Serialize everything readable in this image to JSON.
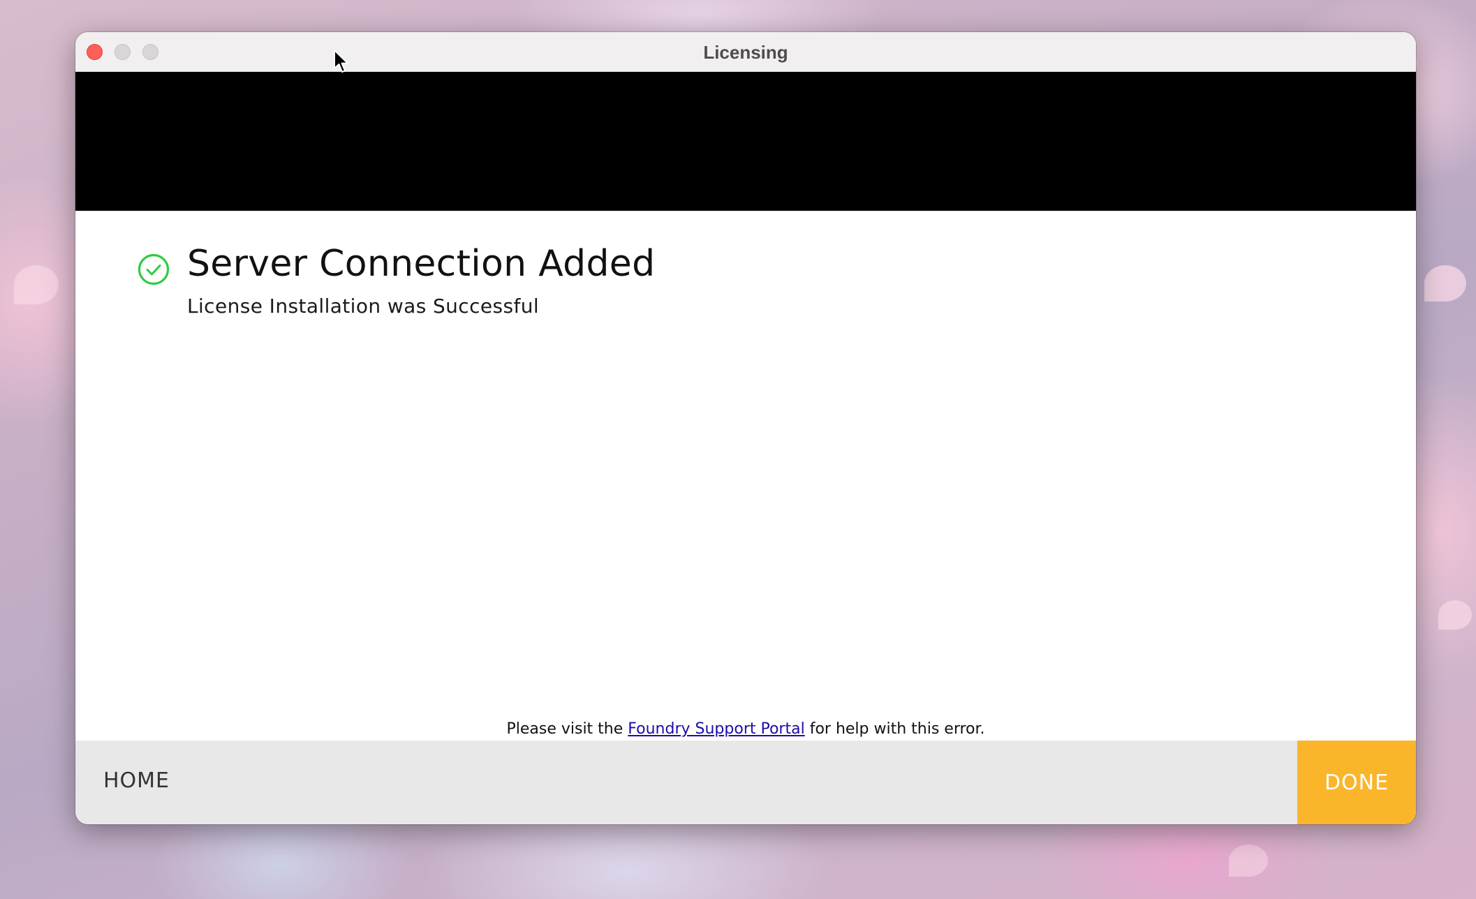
{
  "window": {
    "title": "Licensing"
  },
  "status": {
    "icon": "check-circle-icon",
    "icon_color": "#2ecc40",
    "headline": "Server Connection Added",
    "subline": "License Installation was Successful"
  },
  "help": {
    "prefix": "Please visit the ",
    "link_text": "Foundry Support Portal",
    "suffix": " for help with this error."
  },
  "footer": {
    "home_label": "HOME",
    "done_label": "DONE",
    "done_color": "#fbb52b"
  }
}
